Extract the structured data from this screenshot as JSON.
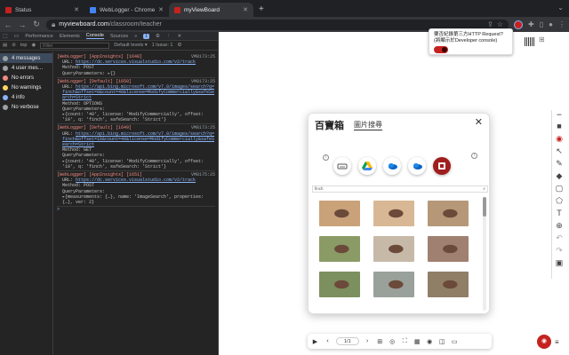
{
  "browser": {
    "tabs": [
      {
        "title": "Status",
        "active": false
      },
      {
        "title": "WebLogger - Chrome Web St…",
        "active": false
      },
      {
        "title": "myViewBoard",
        "active": true
      }
    ],
    "new_tab": "+",
    "url_host": "myviewboard.com",
    "url_path": "/classroom/teacher"
  },
  "devtools": {
    "tabs": [
      "Performance",
      "Elements",
      "Console",
      "Sources"
    ],
    "active_tab": "Console",
    "more_tabs": "»",
    "issues_badge": "1",
    "filter": {
      "context": "top",
      "placeholder": "Filter",
      "levels": "Default levels ▾",
      "issue": "1 Issue: 1"
    },
    "sidebar": [
      {
        "label": "4 messages",
        "color": "#9aa0a6"
      },
      {
        "label": "4 user mes…",
        "color": "#9aa0a6"
      },
      {
        "label": "No errors",
        "color": "#f28b82"
      },
      {
        "label": "No warnings",
        "color": "#fdd663"
      },
      {
        "label": "4 info",
        "color": "#8ab4f8"
      },
      {
        "label": "No verbose",
        "color": "#9aa0a6"
      }
    ],
    "logs": [
      {
        "tag": "[WebLogger] [AppInsights] [1648]",
        "src": "VM8173:25",
        "url_label": "URL:",
        "url": "https://dc.services.visualstudio.com/v2/track",
        "lines": [
          "Method: POST",
          "QueryParameters: ▸{}"
        ]
      },
      {
        "tag": "[WebLogger] [Default] [1650]",
        "src": "VM8173:25",
        "url_label": "URL:",
        "url": "https://api.bing.microsoft.com/v7.0/images/search?q=finch&offset=0&count=40&license=ModifyCommercially&safeSearch=Strict",
        "lines": [
          "Method: OPTIONS",
          "QueryParameters:",
          "▸{count: '40', license: 'ModifyCommercially', offset: '10', q: 'finch', safeSearch: 'Strict'}"
        ]
      },
      {
        "tag": "[WebLogger] [Default] [1649]",
        "src": "VM8173:25",
        "url_label": "URL:",
        "url": "https://api.bing.microsoft.com/v7.0/images/search?q=finch&offset=10&count=40&license=ModifyCommercially&safeSearch=Strict",
        "lines": [
          "Method: GET",
          "QueryParameters:",
          "▸{count: '40', license: 'ModifyCommercially', offset: '10', q: 'finch', safeSearch: 'Strict'}"
        ]
      },
      {
        "tag": "[WebLogger] [AppInsights] [1651]",
        "src": "VM8175:25",
        "url_label": "URL:",
        "url": "https://dc.services.visualstudio.com/v2/track",
        "lines": [
          "Method: POST",
          "QueryParameters:",
          "▸{measurements: {…}, name: 'ImageSearch', properties: {…}, ver: 2}"
        ]
      }
    ],
    "prompt": ">"
  },
  "popup": {
    "line1": "要否紀錄第三方HTTP Request?",
    "line2": "(將顯示於Developer console)",
    "toggle_on": true
  },
  "modal": {
    "title": "百寶箱",
    "subtitle": "圖片搜尋",
    "close": "✕",
    "search_value": "finch",
    "sources": [
      "drive-icon",
      "google-drive-icon",
      "onedrive-icon",
      "onedrive-business-icon",
      "album-icon"
    ],
    "images": [
      {
        "color": "#c9a27a"
      },
      {
        "color": "#d8b894"
      },
      {
        "color": "#b69878"
      },
      {
        "color": "#8a9b66"
      },
      {
        "color": "#c7b9a8"
      },
      {
        "color": "#a08070"
      },
      {
        "color": "#7c8f5e"
      },
      {
        "color": "#9aa09a"
      },
      {
        "color": "#8f7f66"
      }
    ]
  },
  "bottombar": {
    "page": "1/1"
  },
  "accent": "#c5221f"
}
